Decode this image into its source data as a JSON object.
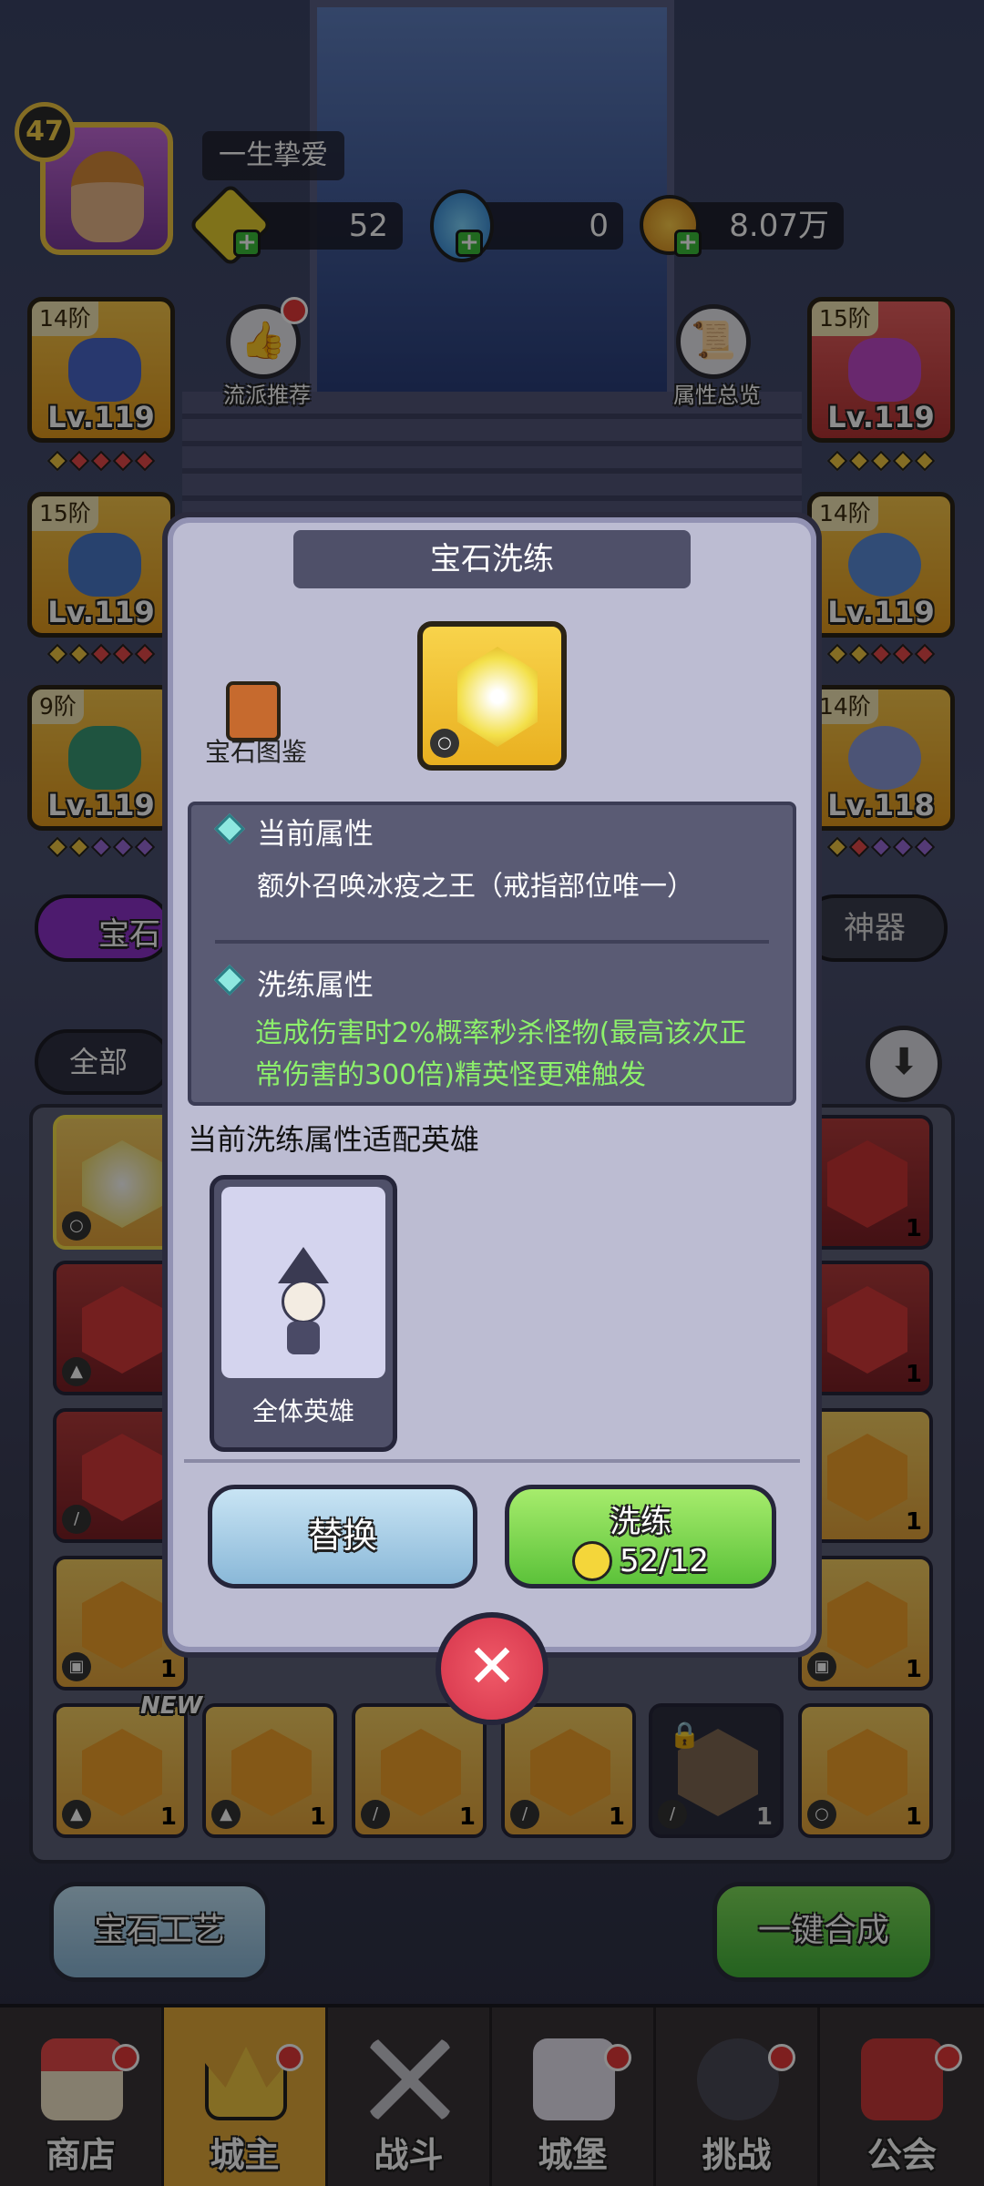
{
  "player": {
    "level": "47",
    "name": "一生挚爱"
  },
  "resources": {
    "gem_currency": "52",
    "potion": "0",
    "gold": "8.07万"
  },
  "equipment": {
    "left": [
      {
        "tier": "14阶",
        "level": "Lv.119",
        "art": "wizard-hat"
      },
      {
        "tier": "15阶",
        "level": "Lv.119",
        "art": "robe"
      },
      {
        "tier": "9阶",
        "level": "Lv.119",
        "art": "boots"
      }
    ],
    "right": [
      {
        "tier": "15阶",
        "level": "Lv.119",
        "art": "staff"
      },
      {
        "tier": "14阶",
        "level": "Lv.119",
        "art": "ring"
      },
      {
        "tier": "14阶",
        "level": "Lv.118",
        "art": "amulet"
      }
    ]
  },
  "side_buttons": {
    "recommend": "流派推荐",
    "overview": "属性总览"
  },
  "tabs": {
    "gem": "宝石",
    "artifact": "神器"
  },
  "filter": {
    "all": "全部"
  },
  "bottom_buttons": {
    "craft": "宝石工艺",
    "merge": "一键合成"
  },
  "grid": {
    "new_label": "NEW"
  },
  "nav": [
    {
      "label": "商店",
      "icon": "shop-icon"
    },
    {
      "label": "城主",
      "icon": "crown-icon",
      "active": true
    },
    {
      "label": "战斗",
      "icon": "swords-icon"
    },
    {
      "label": "城堡",
      "icon": "castle-icon"
    },
    {
      "label": "挑战",
      "icon": "demon-icon"
    },
    {
      "label": "公会",
      "icon": "guild-book-icon"
    }
  ],
  "modal": {
    "title": "宝石洗练",
    "codex": "宝石图鉴",
    "current_header": "当前属性",
    "current_text": "额外召唤冰疫之王（戒指部位唯一）",
    "refine_header": "洗练属性",
    "refine_text": "造成伤害时2%概率秒杀怪物(最高该次正常伤害的300倍)精英怪更难触发",
    "fit_label": "当前洗练属性适配英雄",
    "hero_name": "全体英雄",
    "replace": "替换",
    "refine": "洗练",
    "cost": "52/12"
  }
}
